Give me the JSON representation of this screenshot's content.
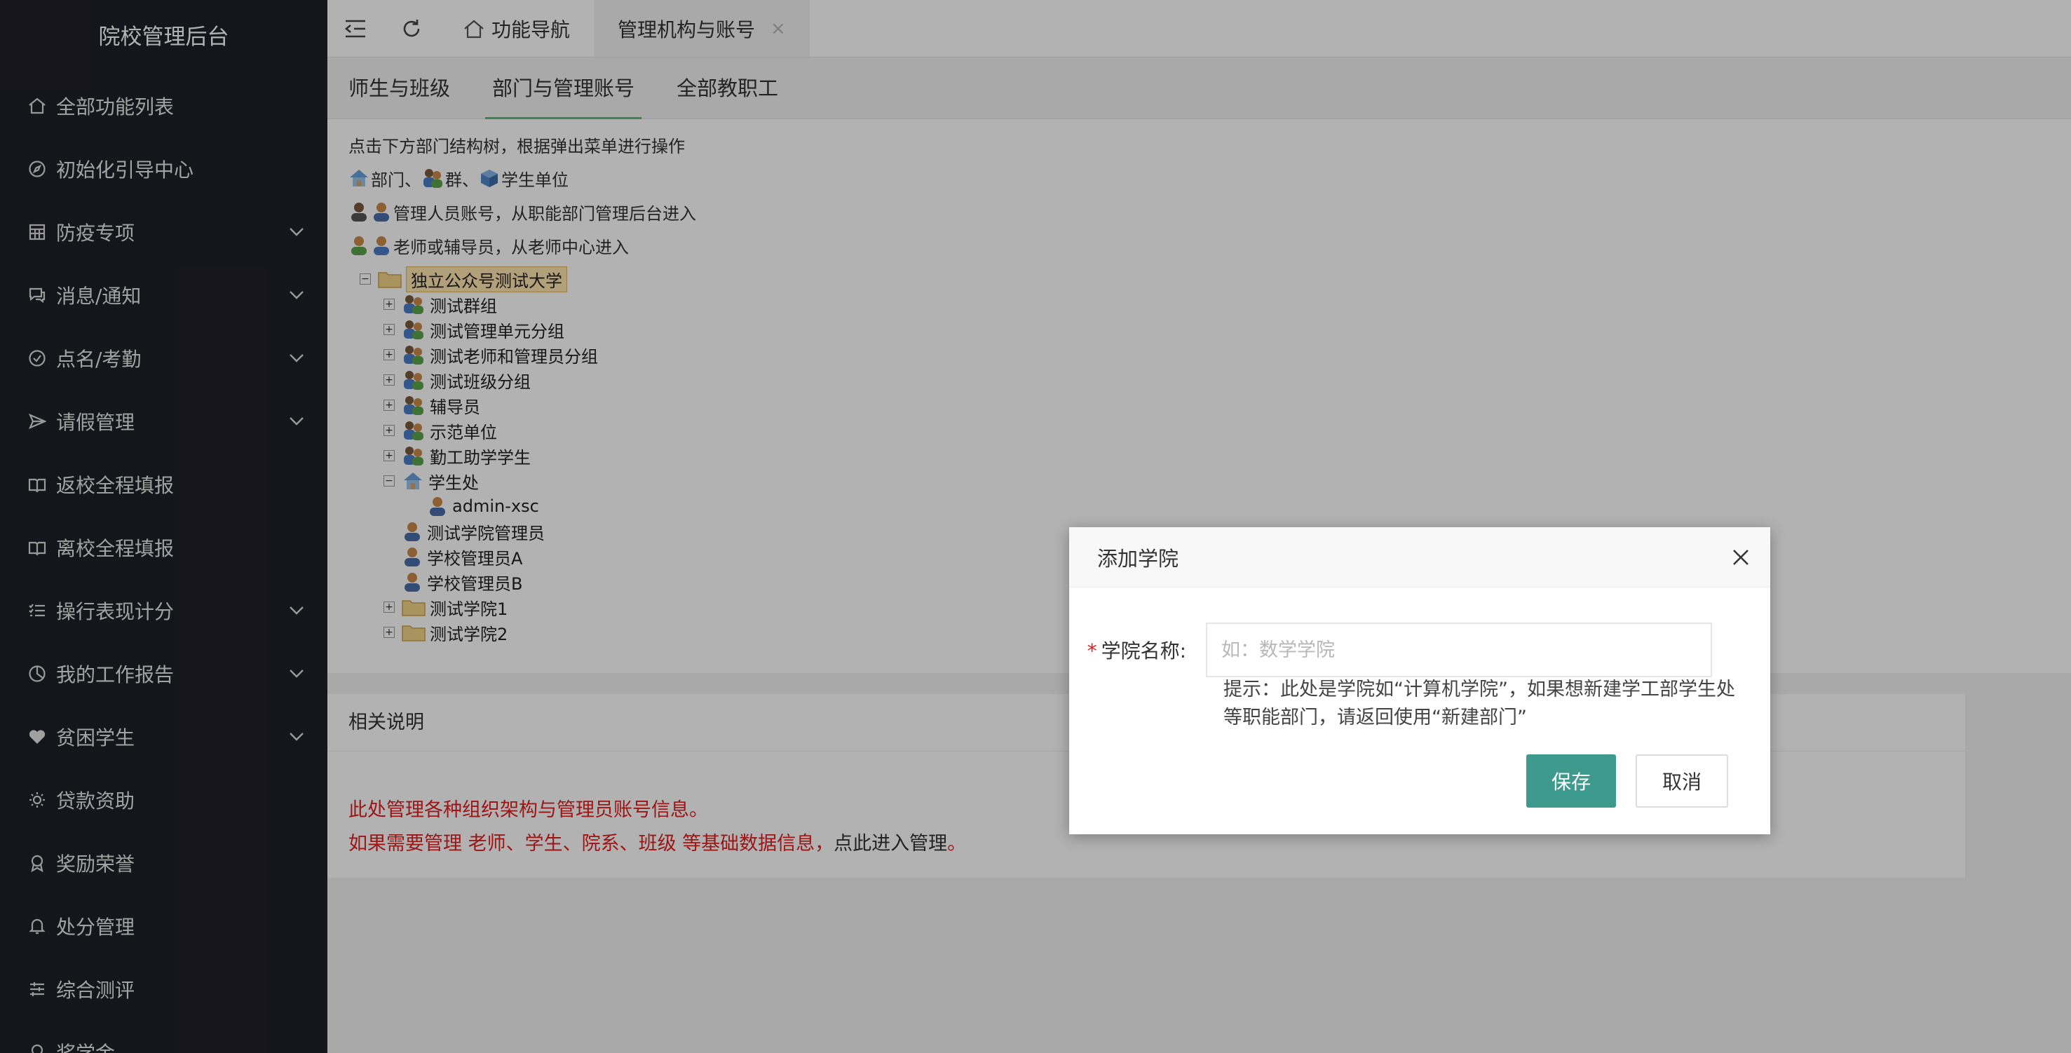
{
  "sidebar": {
    "brand": "院校管理后台",
    "items": [
      {
        "label": "全部功能列表",
        "icon": "home-icon",
        "has_children": false
      },
      {
        "label": "初始化引导中心",
        "icon": "compass-icon",
        "has_children": false
      },
      {
        "label": "防疫专项",
        "icon": "calendar-grid-icon",
        "has_children": true
      },
      {
        "label": "消息/通知",
        "icon": "chat-icon",
        "has_children": true
      },
      {
        "label": "点名/考勤",
        "icon": "check-circle-icon",
        "has_children": true
      },
      {
        "label": "请假管理",
        "icon": "send-icon",
        "has_children": true
      },
      {
        "label": "返校全程填报",
        "icon": "book-open-icon",
        "has_children": false
      },
      {
        "label": "离校全程填报",
        "icon": "book-open-icon",
        "has_children": false
      },
      {
        "label": "操行表现计分",
        "icon": "list-icon",
        "has_children": true
      },
      {
        "label": "我的工作报告",
        "icon": "pie-chart-icon",
        "has_children": true
      },
      {
        "label": "贫困学生",
        "icon": "heart-icon",
        "has_children": true
      },
      {
        "label": "贷款资助",
        "icon": "sun-icon",
        "has_children": false
      },
      {
        "label": "奖励荣誉",
        "icon": "award-icon",
        "has_children": false
      },
      {
        "label": "处分管理",
        "icon": "bell-icon",
        "has_children": false
      },
      {
        "label": "综合测评",
        "icon": "sliders-icon",
        "has_children": false
      },
      {
        "label": "奖学金",
        "icon": "award-icon",
        "has_children": false
      }
    ]
  },
  "topbar": {
    "tabs": [
      {
        "label": "功能导航",
        "active": false
      },
      {
        "label": "管理机构与账号",
        "active": true
      }
    ],
    "close_glyph": "×"
  },
  "subtabs": [
    "师生与班级",
    "部门与管理账号",
    "全部教职工"
  ],
  "tips": {
    "line1": "点击下方部门结构树，根据弹出菜单进行操作",
    "line2_dept": "部门、",
    "line2_group": "群、",
    "line2_unit": "学生单位",
    "line3": "管理人员账号，从职能部门管理后台进入",
    "line4": "老师或辅导员，从老师中心进入"
  },
  "tree": {
    "root": "独立公众号测试大学",
    "groups": [
      "测试群组",
      "测试管理单元分组",
      "测试老师和管理员分组",
      "测试班级分组",
      "辅导员",
      "示范单位",
      "勤工助学学生"
    ],
    "dept": "学生处",
    "dept_child": "admin-xsc",
    "admins": [
      "测试学院管理员",
      "学校管理员A",
      "学校管理员B"
    ],
    "colleges": [
      "测试学院1",
      "测试学院2"
    ],
    "plus": "+",
    "minus": "−"
  },
  "notes": {
    "title": "相关说明",
    "line1": "此处管理各种组织架构与管理员账号信息。",
    "line2_red": "如果需要管理 老师、学生、院系、班级 等基础数据信息，",
    "line2_plain": "点此进入管理",
    "line2_end": "。"
  },
  "modal": {
    "title": "添加学院",
    "required_mark": "*",
    "field_label": "学院名称:",
    "placeholder": "如：数学学院",
    "value": "",
    "hint": "提示：此处是学院如“计算机学院”，如果想新建学工部学生处等职能部门，请返回使用“新建部门”",
    "save_label": "保存",
    "cancel_label": "取消"
  },
  "colors": {
    "sidebar_bg": "#1f2028",
    "accent_green": "#5fb878",
    "save_button": "#3d9a8c",
    "note_red": "#e02020"
  }
}
